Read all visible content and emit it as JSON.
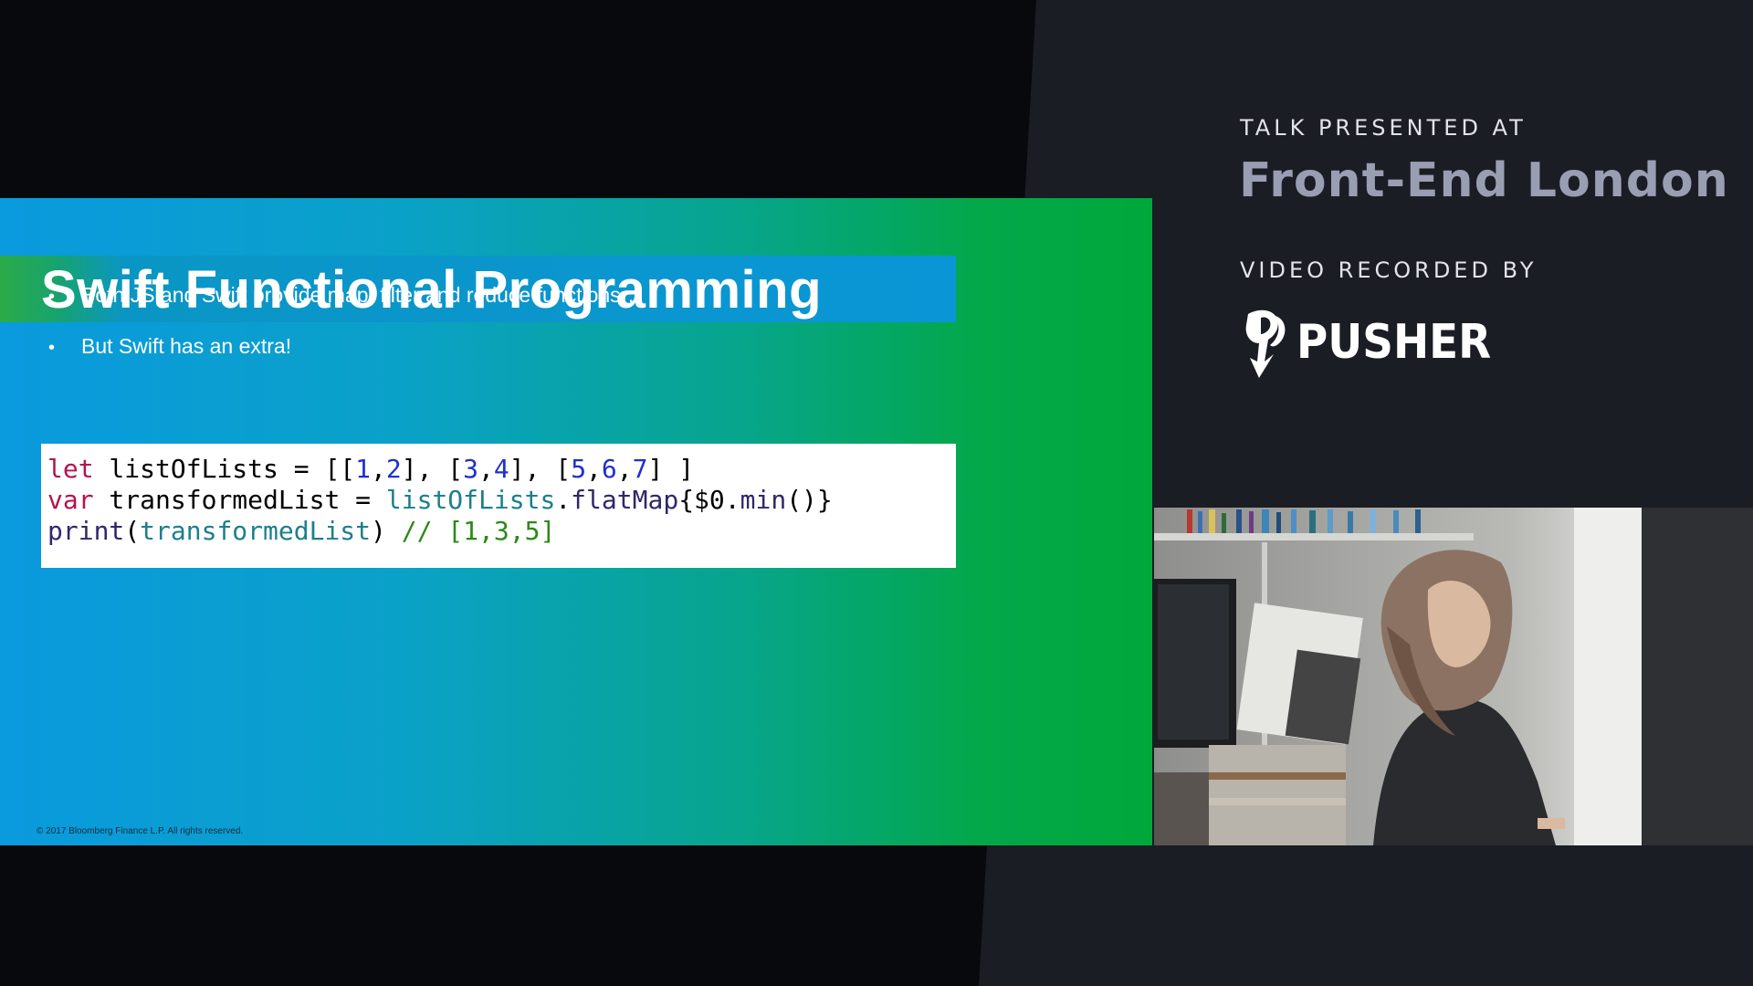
{
  "slide": {
    "title": "Swift Functional Programming",
    "bullets": [
      "Both JS and Swift provide map, filter and reduce functions…",
      "But Swift has an extra!"
    ],
    "bullet_symbol": "•",
    "code": {
      "line1": {
        "kw": "let",
        "a": " listOfLists = [[",
        "n1": "1",
        "c1": ",",
        "n2": "2",
        "b": "], [",
        "n3": "3",
        "c2": ",",
        "n4": "4",
        "c": "], [",
        "n5": "5",
        "c3": ",",
        "n6": "6",
        "c4": ",",
        "n7": "7",
        "d": "] ]"
      },
      "line2": {
        "kw": "var",
        "a": " transformedList = ",
        "fn": "listOfLists",
        "dot": ".",
        "mth": "flatMap",
        "b": "{$0.",
        "mth2": "min",
        "c": "()}"
      },
      "line3": {
        "fn1": "print",
        "a": "(",
        "fn2": "transformedList",
        "b": ") ",
        "cm": "// [1,3,5]"
      }
    },
    "copyright": "© 2017 Bloomberg Finance L.P.  All rights reserved."
  },
  "sidebar": {
    "talk_label": "TALK PRESENTED AT",
    "event_name": "Front-End London",
    "video_label": "VIDEO RECORDED BY",
    "brand": "PUSHER"
  },
  "icons": {
    "logo": "pusher-logo-icon"
  },
  "colors": {
    "slide_blue": "#0a9ade",
    "slide_green": "#00a83a",
    "sidebar_bg": "#1b1d24",
    "event_name": "#9a9eb2"
  }
}
